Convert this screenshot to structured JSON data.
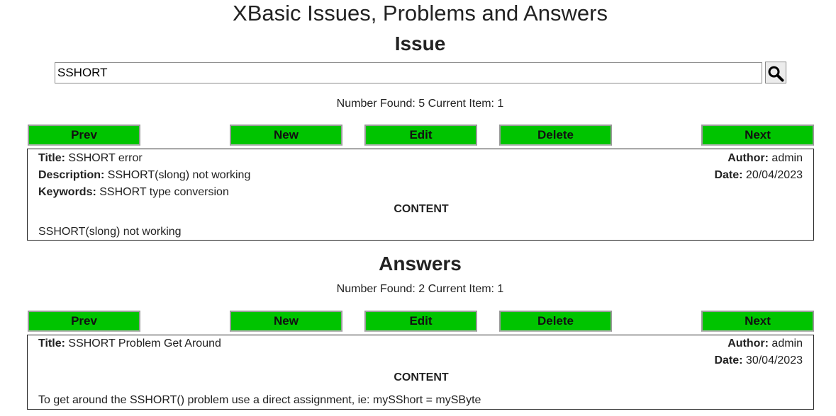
{
  "page": {
    "title": "XBasic Issues, Problems and Answers"
  },
  "issue": {
    "heading": "Issue",
    "search": {
      "value": "SSHORT",
      "placeholder": ""
    },
    "count_text": "Number Found: 5 Current Item: 1",
    "buttons": {
      "prev": "Prev",
      "new": "New",
      "edit": "Edit",
      "delete": "Delete",
      "next": "Next"
    },
    "record": {
      "title_label": "Title:",
      "title": "SSHORT error",
      "description_label": "Description:",
      "description": "SSHORT(slong) not working",
      "keywords_label": "Keywords:",
      "keywords": "SSHORT type conversion",
      "author_label": "Author:",
      "author": "admin",
      "date_label": "Date:",
      "date": "20/04/2023",
      "content_label": "CONTENT",
      "content": "SSHORT(slong) not working"
    }
  },
  "answers": {
    "heading": "Answers",
    "count_text": "Number Found: 2 Current Item: 1",
    "buttons": {
      "prev": "Prev",
      "new": "New",
      "edit": "Edit",
      "delete": "Delete",
      "next": "Next"
    },
    "record": {
      "title_label": "Title:",
      "title": "SSHORT Problem Get Around",
      "author_label": "Author:",
      "author": "admin",
      "date_label": "Date:",
      "date": "30/04/2023",
      "content_label": "CONTENT",
      "content": "To get around the SSHORT() problem use a direct assignment, ie: mySShort = mySByte"
    }
  },
  "colors": {
    "button_green": "#00c400",
    "text": "#222222",
    "border": "#222222"
  },
  "icons": {
    "search": "magnifier-icon"
  }
}
